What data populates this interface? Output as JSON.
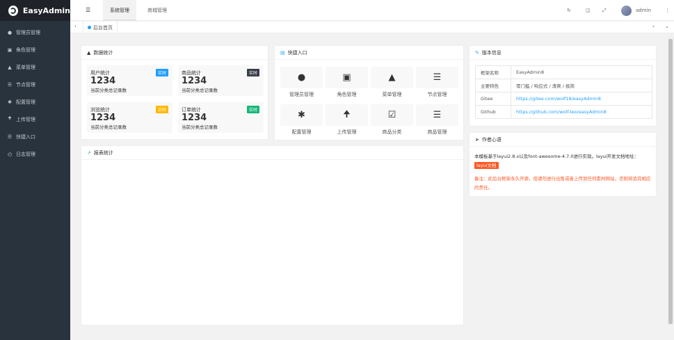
{
  "app": {
    "title": "EasyAdmin"
  },
  "sidebar": {
    "items": [
      {
        "label": "管理员管理",
        "icon": "user-icon"
      },
      {
        "label": "角色管理",
        "icon": "id-card-icon"
      },
      {
        "label": "菜单管理",
        "icon": "tree-icon"
      },
      {
        "label": "节点管理",
        "icon": "list-icon"
      },
      {
        "label": "配置管理",
        "icon": "asterisk-icon"
      },
      {
        "label": "上传管理",
        "icon": "arrow-up-icon"
      },
      {
        "label": "快捷入口",
        "icon": "list-icon"
      },
      {
        "label": "日志管理",
        "icon": "clock-icon"
      }
    ]
  },
  "header": {
    "tabs": [
      "系统管理",
      "商城管理"
    ],
    "user": "admin"
  },
  "tabbar": {
    "home_label": "后台首页"
  },
  "stats": {
    "title": "数据统计",
    "items": [
      {
        "title": "用户统计",
        "badge": "实时",
        "badge_color": "#1e9fff",
        "num": "1234",
        "desc": "当前分类总记录数"
      },
      {
        "title": "商品统计",
        "badge": "实时",
        "badge_color": "#393d49",
        "num": "1234",
        "desc": "当前分类总记录数"
      },
      {
        "title": "浏览统计",
        "badge": "实时",
        "badge_color": "#ffb800",
        "num": "1234",
        "desc": "当前分类总记录数"
      },
      {
        "title": "订单统计",
        "badge": "实时",
        "badge_color": "#16b777",
        "num": "1234",
        "desc": "当前分类总记录数"
      }
    ]
  },
  "quick": {
    "title": "快捷入口",
    "items": [
      {
        "label": "管理员管理",
        "icon": "user-icon"
      },
      {
        "label": "角色管理",
        "icon": "id-card-icon"
      },
      {
        "label": "菜单管理",
        "icon": "tree-icon"
      },
      {
        "label": "节点管理",
        "icon": "list-icon"
      },
      {
        "label": "配置管理",
        "icon": "asterisk-icon"
      },
      {
        "label": "上传管理",
        "icon": "arrow-up-icon"
      },
      {
        "label": "商品分类",
        "icon": "calendar-check-icon"
      },
      {
        "label": "商品管理",
        "icon": "list-icon"
      }
    ]
  },
  "chart_panel": {
    "title": "报表统计"
  },
  "version": {
    "title": "版本信息",
    "rows": [
      {
        "key": "框架名称",
        "value": "EasyAdmin8"
      },
      {
        "key": "主要特色",
        "value": "零门槛 / 响应式 / 清爽 / 极简"
      },
      {
        "key": "Gitee",
        "value": "https://gitee.com/wolf18/easyAdmin8"
      },
      {
        "key": "Github",
        "value": "https://github.com/wolf-leo/easyAdmin8"
      }
    ]
  },
  "author": {
    "title": "作者心语",
    "text": "本模板基于layui2.8.x以及font-awesome-4.7.0进行实现。layui开发文档地址：",
    "doc_tag": "layui文档",
    "note": "备注：此后台框架永久开源，但请勿进行出售或者上传到任何素材网站，否则将追究相应的责任。"
  }
}
